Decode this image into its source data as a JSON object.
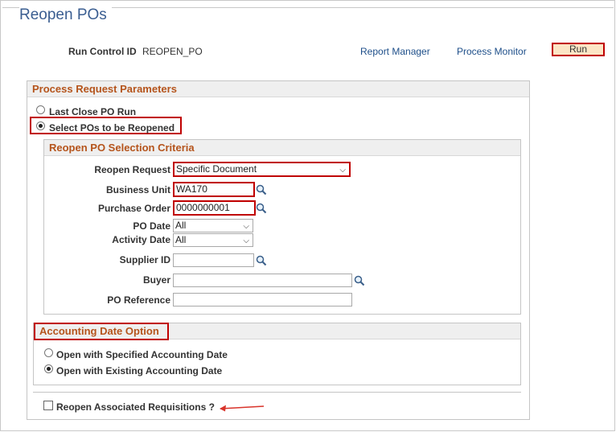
{
  "page": {
    "title": "Reopen POs"
  },
  "run_control": {
    "label": "Run Control ID",
    "value": "REOPEN_PO"
  },
  "links": {
    "report_manager": "Report Manager",
    "process_monitor": "Process Monitor"
  },
  "buttons": {
    "run": "Run"
  },
  "process_request": {
    "header": "Process Request Parameters",
    "options": [
      {
        "label": "Last Close PO Run",
        "selected": false
      },
      {
        "label": "Select POs to be Reopened",
        "selected": true
      }
    ]
  },
  "criteria": {
    "header": "Reopen PO Selection Criteria",
    "reopen_request": {
      "label": "Reopen Request",
      "value": "Specific Document"
    },
    "business_unit": {
      "label": "Business Unit",
      "value": "WA170"
    },
    "purchase_order": {
      "label": "Purchase Order",
      "value": "0000000001"
    },
    "po_date": {
      "label": "PO Date",
      "value": "All"
    },
    "activity_date": {
      "label": "Activity Date",
      "value": "All"
    },
    "supplier_id": {
      "label": "Supplier ID",
      "value": ""
    },
    "buyer": {
      "label": "Buyer",
      "value": ""
    },
    "po_reference": {
      "label": "PO Reference",
      "value": ""
    }
  },
  "accounting": {
    "header": "Accounting Date Option",
    "options": [
      {
        "label": "Open with Specified Accounting Date",
        "selected": false
      },
      {
        "label": "Open with Existing Accounting Date",
        "selected": true
      }
    ]
  },
  "requisitions": {
    "label": "Reopen Associated Requisitions ?",
    "checked": false
  },
  "colors": {
    "highlight": "#c00000",
    "title": "#3b5e91",
    "section_header": "#b5541c",
    "link": "#1d4e89"
  }
}
